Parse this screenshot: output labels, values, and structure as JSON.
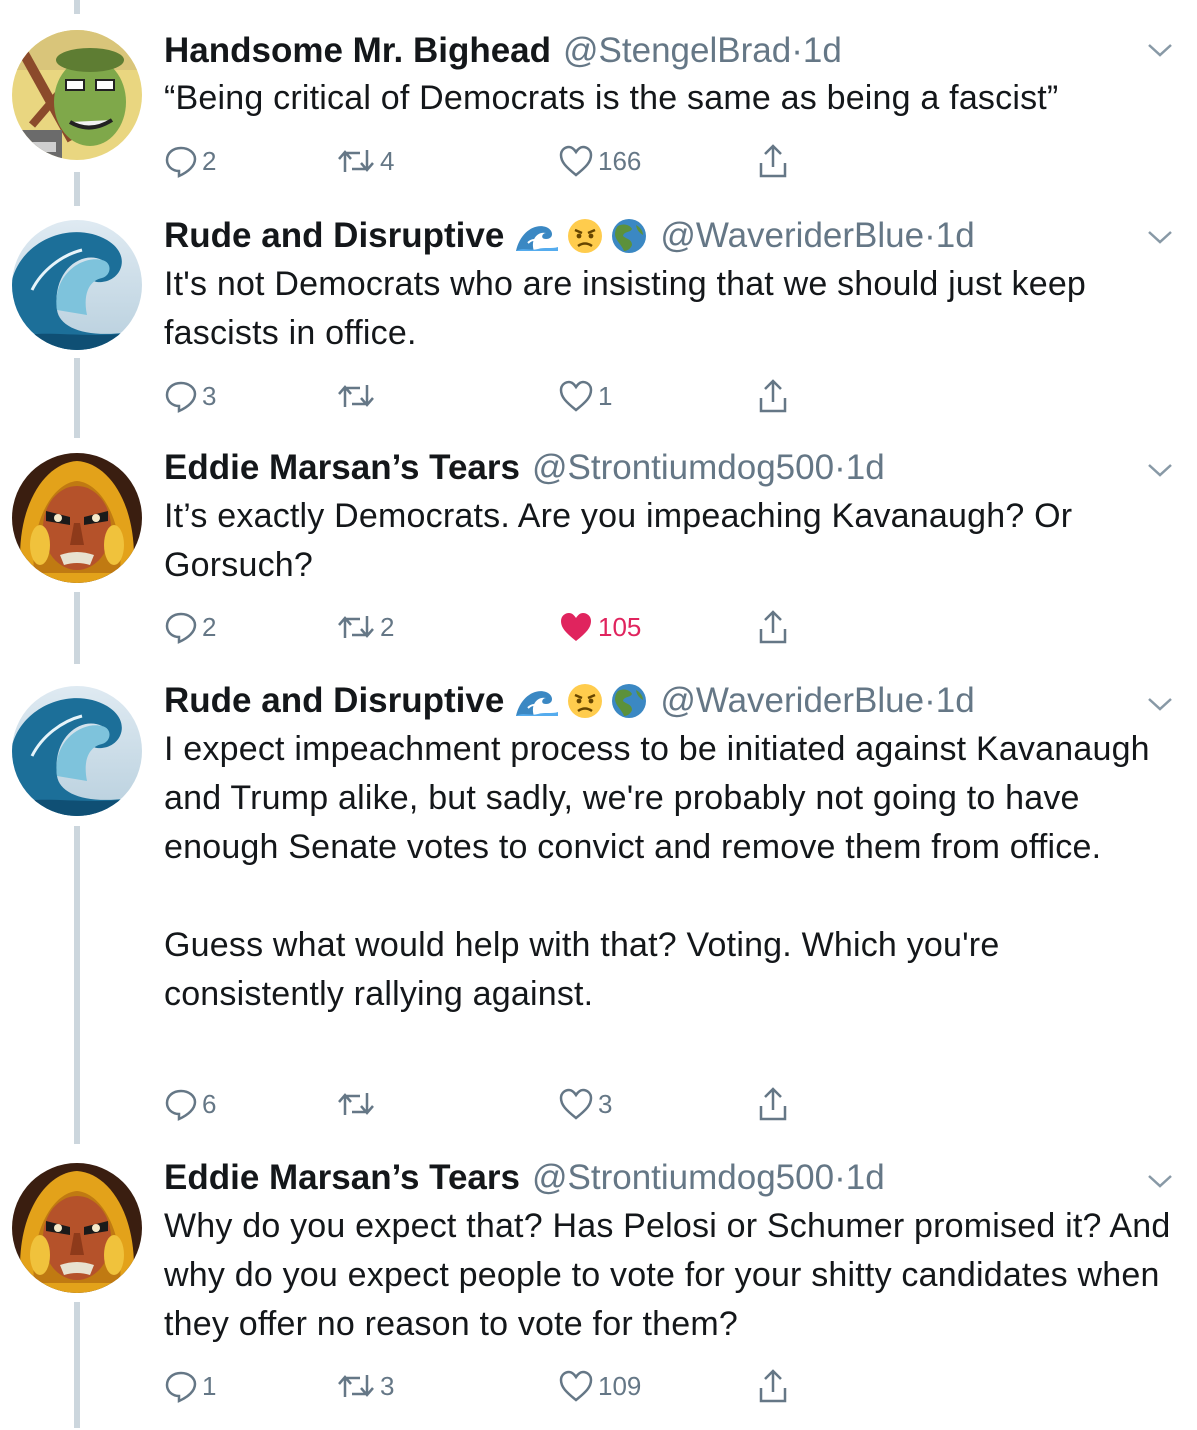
{
  "tweets": [
    {
      "display_name": "Handsome Mr. Bighead",
      "emojis": [],
      "handle": "@StengelBrad",
      "time": "1d",
      "text": "“Being critical of Democrats is the same as being a fascist”",
      "replies": "2",
      "retweets": "4",
      "likes": "166",
      "liked": false,
      "avatar": "green-cartoon-avatar"
    },
    {
      "display_name": "Rude and Disruptive",
      "emojis": [
        "wave-emoji",
        "angry-face-emoji",
        "globe-americas-emoji"
      ],
      "handle": "@WaveriderBlue",
      "time": "1d",
      "text": "It's not Democrats who are insisting that we should just keep fascists in office.",
      "replies": "3",
      "retweets": "",
      "likes": "1",
      "liked": false,
      "avatar": "ocean-wave-avatar"
    },
    {
      "display_name": "Eddie Marsan’s Tears",
      "emojis": [],
      "handle": "@Strontiumdog500",
      "time": "1d",
      "text": "It’s exactly Democrats. Are you impeaching Kavanaugh? Or Gorsuch?",
      "replies": "2",
      "retweets": "2",
      "likes": "105",
      "liked": true,
      "avatar": "helmeted-comic-avatar"
    },
    {
      "display_name": "Rude and Disruptive",
      "emojis": [
        "wave-emoji",
        "angry-face-emoji",
        "globe-americas-emoji"
      ],
      "handle": "@WaveriderBlue",
      "time": "1d",
      "text": "I expect impeachment process to be initiated against Kavanaugh and Trump alike, but sadly, we're probably not going to have enough Senate votes to convict and remove them from office.\n\nGuess what would help with that? Voting. Which you're consistently rallying against.",
      "replies": "6",
      "retweets": "",
      "likes": "3",
      "liked": false,
      "avatar": "ocean-wave-avatar"
    },
    {
      "display_name": "Eddie Marsan’s Tears",
      "emojis": [],
      "handle": "@Strontiumdog500",
      "time": "1d",
      "text": "Why do you expect that? Has Pelosi or Schumer promised it? And why do you expect people to vote for your shitty candidates when they offer no reason to vote for them?",
      "replies": "1",
      "retweets": "3",
      "likes": "109",
      "liked": false,
      "avatar": "helmeted-comic-avatar"
    }
  ],
  "colors": {
    "text": "#14171a",
    "secondary": "#657786",
    "thread_line": "#ccd6dd",
    "like_active": "#e0245e"
  },
  "time_separator": "·"
}
